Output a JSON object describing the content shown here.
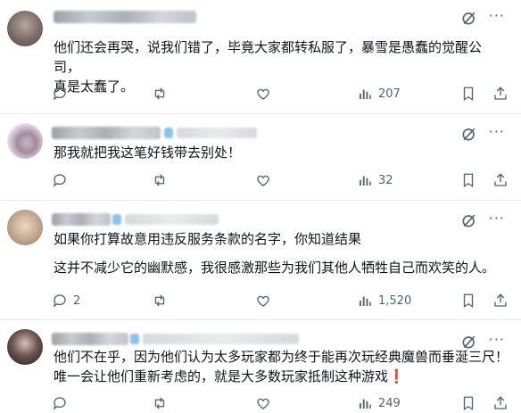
{
  "posts": [
    {
      "lines": [
        "他们还会再哭，说我们错了，毕竟大家都转私服了，暴雪是愚蠢的觉醒公司，",
        "真是太蠢了。"
      ],
      "reply_count": "",
      "repost_count": "",
      "like_count": "",
      "views": "207"
    },
    {
      "lines": [
        "那我就把我这笔好钱带去别处！"
      ],
      "reply_count": "",
      "repost_count": "",
      "like_count": "",
      "views": "32"
    },
    {
      "lines": [
        "如果你打算故意用违反服务条款的名字，你知道结果",
        "",
        "这并不减少它的幽默感，我很感激那些为我们其他人牺牲自己而欢笑的人。"
      ],
      "reply_count": "2",
      "repost_count": "",
      "like_count": "",
      "views": "1,520"
    },
    {
      "lines": [
        "他们不在乎，因为他们认为太多玩家都为终于能再次玩经典魔兽而垂涎三尺！",
        "唯一会让他们重新考虑的，就是大多数玩家抵制这种游戏"
      ],
      "mark": "❗",
      "reply_count": "",
      "repost_count": "",
      "like_count": "",
      "views": "249"
    }
  ],
  "icons": {
    "grok": "grok-icon",
    "more": "more-icon",
    "reply": "reply-icon",
    "repost": "repost-icon",
    "like": "like-icon",
    "views": "views-icon",
    "bookmark": "bookmark-icon",
    "share": "share-icon"
  },
  "colors": {
    "text": "#0f1419",
    "muted": "#536471",
    "divider": "#e7e9ea",
    "alert": "#e0245e"
  }
}
